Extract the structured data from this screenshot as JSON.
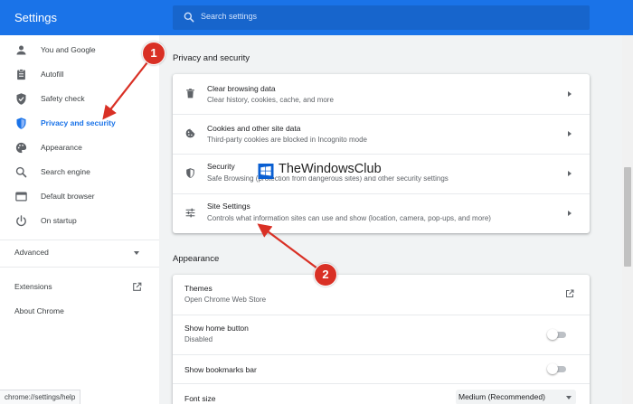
{
  "app": {
    "title": "Settings"
  },
  "search": {
    "placeholder": "Search settings"
  },
  "sidebar": {
    "items": [
      {
        "label": "You and Google",
        "icon": "person-icon"
      },
      {
        "label": "Autofill",
        "icon": "clipboard-icon"
      },
      {
        "label": "Safety check",
        "icon": "shield-check-icon"
      },
      {
        "label": "Privacy and security",
        "icon": "shield-half-icon",
        "active": true
      },
      {
        "label": "Appearance",
        "icon": "palette-icon"
      },
      {
        "label": "Search engine",
        "icon": "search-icon"
      },
      {
        "label": "Default browser",
        "icon": "browser-icon"
      },
      {
        "label": "On startup",
        "icon": "power-icon"
      }
    ],
    "advanced": "Advanced",
    "extensions": "Extensions",
    "about": "About Chrome"
  },
  "status_bar": {
    "url": "chrome://settings/help"
  },
  "privacy": {
    "heading": "Privacy and security",
    "rows": [
      {
        "title": "Clear browsing data",
        "subtitle": "Clear history, cookies, cache, and more",
        "icon": "trash-icon"
      },
      {
        "title": "Cookies and other site data",
        "subtitle": "Third-party cookies are blocked in Incognito mode",
        "icon": "cookie-icon"
      },
      {
        "title": "Security",
        "subtitle": "Safe Browsing (protection from dangerous sites) and other security settings",
        "icon": "shield-half-icon"
      },
      {
        "title": "Site Settings",
        "subtitle": "Controls what information sites can use and show (location, camera, pop-ups, and more)",
        "icon": "sliders-icon"
      }
    ]
  },
  "appearance": {
    "heading": "Appearance",
    "themes": {
      "title": "Themes",
      "subtitle": "Open Chrome Web Store"
    },
    "home_button": {
      "title": "Show home button",
      "subtitle": "Disabled",
      "enabled": false
    },
    "bookmarks_bar": {
      "title": "Show bookmarks bar",
      "enabled": false
    },
    "font_size": {
      "title": "Font size",
      "value": "Medium (Recommended)"
    }
  },
  "watermark": {
    "text": "TheWindowsClub"
  },
  "annotations": {
    "step1": "1",
    "step2": "2"
  },
  "colors": {
    "accent": "#1a73e8",
    "annotation": "#d93025"
  }
}
